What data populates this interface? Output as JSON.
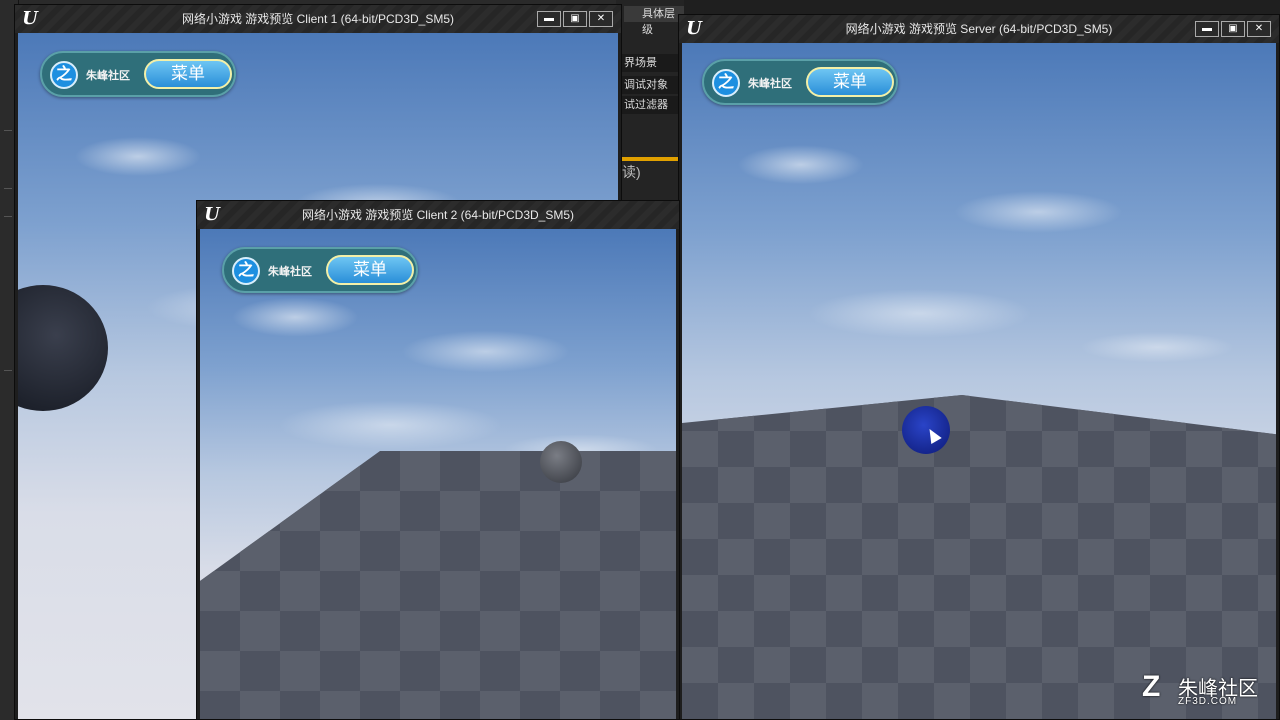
{
  "editor": {
    "tab_label": "具体层级",
    "rows": [
      "界场景",
      "调试对象",
      "试过滤器"
    ],
    "readonly_fragment": "读)",
    "logo": "U"
  },
  "windows": {
    "client1": {
      "title": "网络小游戏 游戏预览 Client 1 (64-bit/PCD3D_SM5)",
      "logo": "U",
      "minimize": "▬",
      "maximize": "▣",
      "close": "✕"
    },
    "client2": {
      "title": "网络小游戏 游戏预览 Client 2 (64-bit/PCD3D_SM5)",
      "logo": "U"
    },
    "server": {
      "title": "网络小游戏 游戏预览 Server (64-bit/PCD3D_SM5)",
      "logo": "U",
      "minimize": "▬",
      "maximize": "▣",
      "close": "✕"
    }
  },
  "hud": {
    "logo_glyph": "之",
    "community_name": "朱峰社区",
    "menu_label": "菜单"
  },
  "watermark": {
    "icon": "Z",
    "text": "朱峰社区",
    "domain": "ZF3D.COM"
  },
  "colors": {
    "hud_bg": "#2f6f7a",
    "menu_button": "#3aa0e4",
    "server_ball": "#1a2fa0",
    "client_ball": "#5c5f66"
  }
}
